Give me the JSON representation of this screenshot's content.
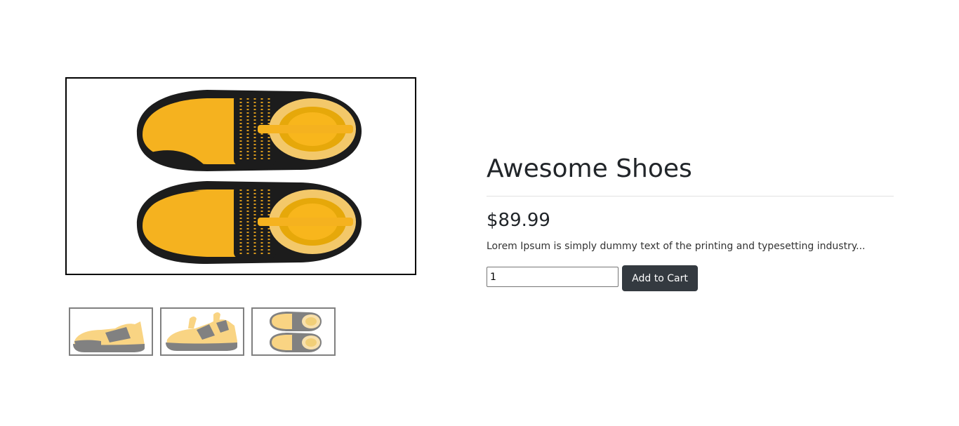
{
  "product": {
    "title": "Awesome Shoes",
    "price": "$89.99",
    "description": "Lorem Ipsum is simply dummy text of the printing and typesetting industry...",
    "quantity_value": "1",
    "add_to_cart_label": "Add to Cart"
  },
  "gallery": {
    "main_image_icon": "shoe-pair-top-view-image",
    "thumbnails": [
      {
        "icon": "shoe-side-view-image"
      },
      {
        "icon": "shoe-angled-view-image"
      },
      {
        "icon": "shoe-pair-top-view-image"
      }
    ]
  },
  "colors": {
    "shoe_yellow": "#f5b21f",
    "shoe_black": "#1c1c1c",
    "button_dark": "#343a40",
    "frame_border": "#000000",
    "thumb_border": "#808080"
  }
}
